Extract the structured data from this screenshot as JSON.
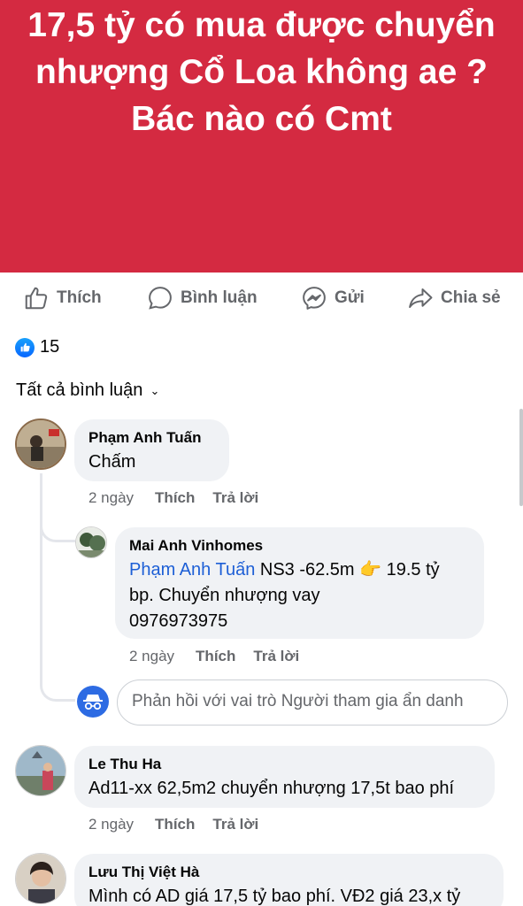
{
  "post": {
    "text": "17,5 tỷ có mua được chuyển nhượng Cổ Loa không ae ? Bác nào có Cmt",
    "background_color": "#d42a41"
  },
  "actions": {
    "like": "Thích",
    "comment": "Bình luận",
    "send": "Gửi",
    "share": "Chia sẻ"
  },
  "reactions": {
    "count": "15",
    "icon": "like-icon"
  },
  "sort": {
    "label": "Tất cả bình luận",
    "icon": "chevron-down-icon"
  },
  "comments": [
    {
      "name": "Phạm Anh Tuấn",
      "text": "Chấm",
      "time": "2 ngày",
      "like": "Thích",
      "reply": "Trả lời",
      "replies": [
        {
          "name": "Mai Anh Vinhomes",
          "mention": "Phạm Anh Tuấn",
          "text_line1": " NS3 -62.5m 👉 19.5 tỷ",
          "text_line2": "bp. Chuyển nhượng vay",
          "text_line3": "0976973975",
          "time": "2 ngày",
          "like": "Thích",
          "reply": "Trả lời"
        }
      ],
      "reply_placeholder": "Phản hồi với vai trò Người tham gia ẩn danh"
    },
    {
      "name": "Le Thu Ha",
      "text": "Ad11-xx 62,5m2 chuyển nhượng 17,5t bao phí",
      "time": "2 ngày",
      "like": "Thích",
      "reply": "Trả lời"
    },
    {
      "name": "Lưu Thị Việt Hà",
      "text": "Mình có AD giá 17,5 tỷ bao phí. VĐ2 giá 23,x tỷ"
    }
  ]
}
